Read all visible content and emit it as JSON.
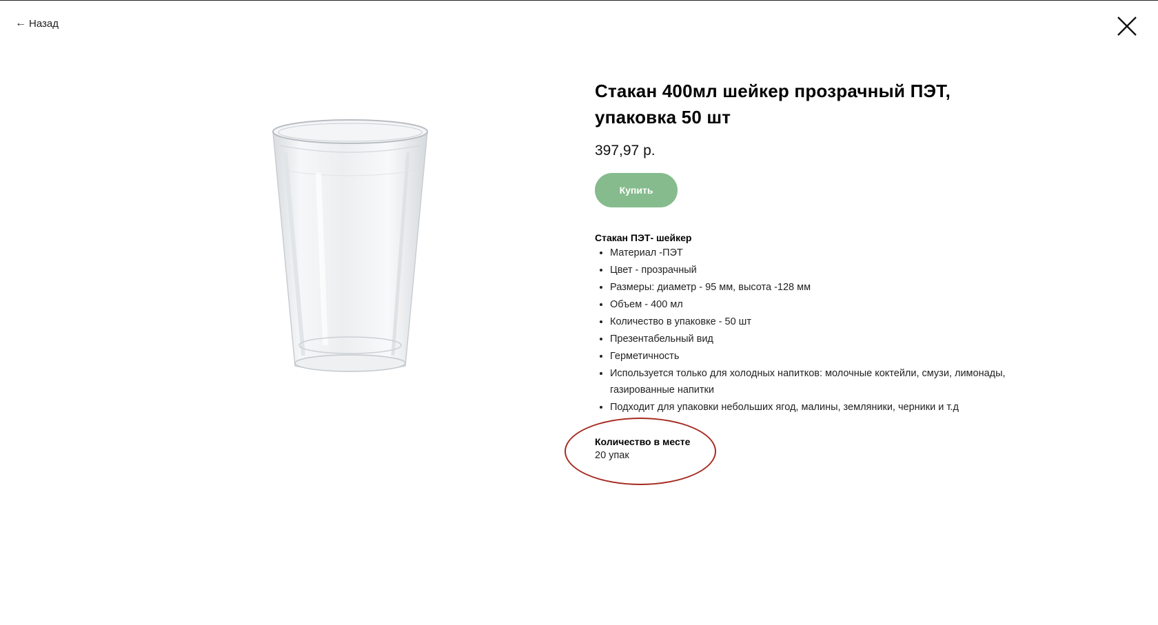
{
  "nav": {
    "back_label": "Назад",
    "back_icon": "arrow-left-icon",
    "close_icon": "close-icon"
  },
  "product": {
    "image_icon": "plastic-cup-image",
    "title": "Стакан 400мл шейкер прозрачный ПЭТ, упаковка 50 шт",
    "price": "397,97 р.",
    "buy_label": "Купить",
    "description_heading": "Стакан ПЭТ- шейкер",
    "features": [
      "Материал -ПЭТ",
      "Цвет - прозрачный",
      "Размеры: диаметр - 95 мм, высота -128 мм",
      "Объем - 400 мл",
      "Количество в упаковке - 50 шт",
      "Презентабельный вид",
      "Герметичность",
      "Используется только для холодных напитков: молочные коктейли, смузи, лимонады, газированные напитки",
      "Подходит для упаковки небольших ягод, малины, земляники, черники и т.д"
    ],
    "quantity_label": "Количество в месте",
    "quantity_value": "20 упак"
  },
  "colors": {
    "buy_button": "#86bb8d",
    "annotation_circle": "#a52a1f"
  }
}
